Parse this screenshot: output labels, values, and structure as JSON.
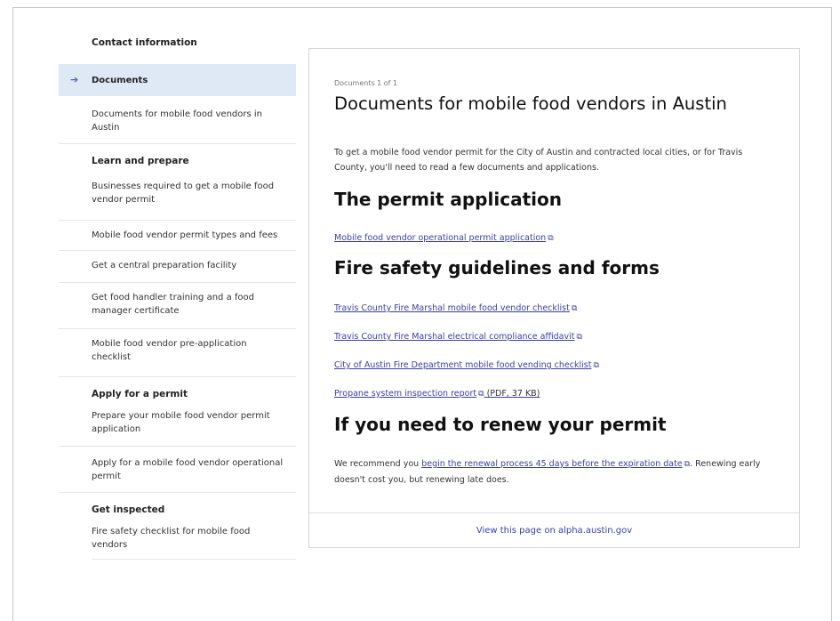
{
  "sidebar": {
    "contact": "Contact information",
    "documents": "Documents",
    "documents_sub": "Documents for mobile food vendors in Austin",
    "learn_head": "Learn and prepare",
    "learn_items": [
      "Businesses required to get a mobile food vendor permit",
      "Mobile food vendor permit types and fees",
      "Get a central preparation facility",
      "Get food handler training and a food manager certificate",
      "Mobile food vendor pre-application checklist"
    ],
    "apply_head": "Apply for a permit",
    "apply_items": [
      "Prepare your mobile food vendor permit application",
      "Apply for a mobile food vendor operational permit"
    ],
    "inspect_head": "Get inspected",
    "inspect_items": [
      "Fire safety checklist for mobile food vendors"
    ]
  },
  "main": {
    "crumb": "Documents 1 of 1",
    "title": "Documents for mobile food vendors in Austin",
    "intro": "To get a mobile food vendor permit for the City of Austin and contracted local cities, or for Travis County, you'll need to read a few documents and applications.",
    "h_permit": "The permit application",
    "link_permit": "Mobile food vendor operational permit application",
    "h_fire": "Fire safety guidelines and forms",
    "fire_links": [
      "Travis County Fire Marshal mobile food vendor checklist",
      "Travis County Fire Marshal electrical compliance affidavit",
      "City of Austin Fire Department mobile food vending checklist",
      "Propane system inspection report"
    ],
    "propane_note": "(PDF, 37 KB)",
    "h_renew": "If you need to renew your permit",
    "renew_pre": "We recommend you ",
    "renew_link": "begin the renewal process 45 days before the expiration date",
    "renew_post": ". Renewing early doesn't cost you, but renewing late does.",
    "footer": "View this page on alpha.austin.gov"
  }
}
